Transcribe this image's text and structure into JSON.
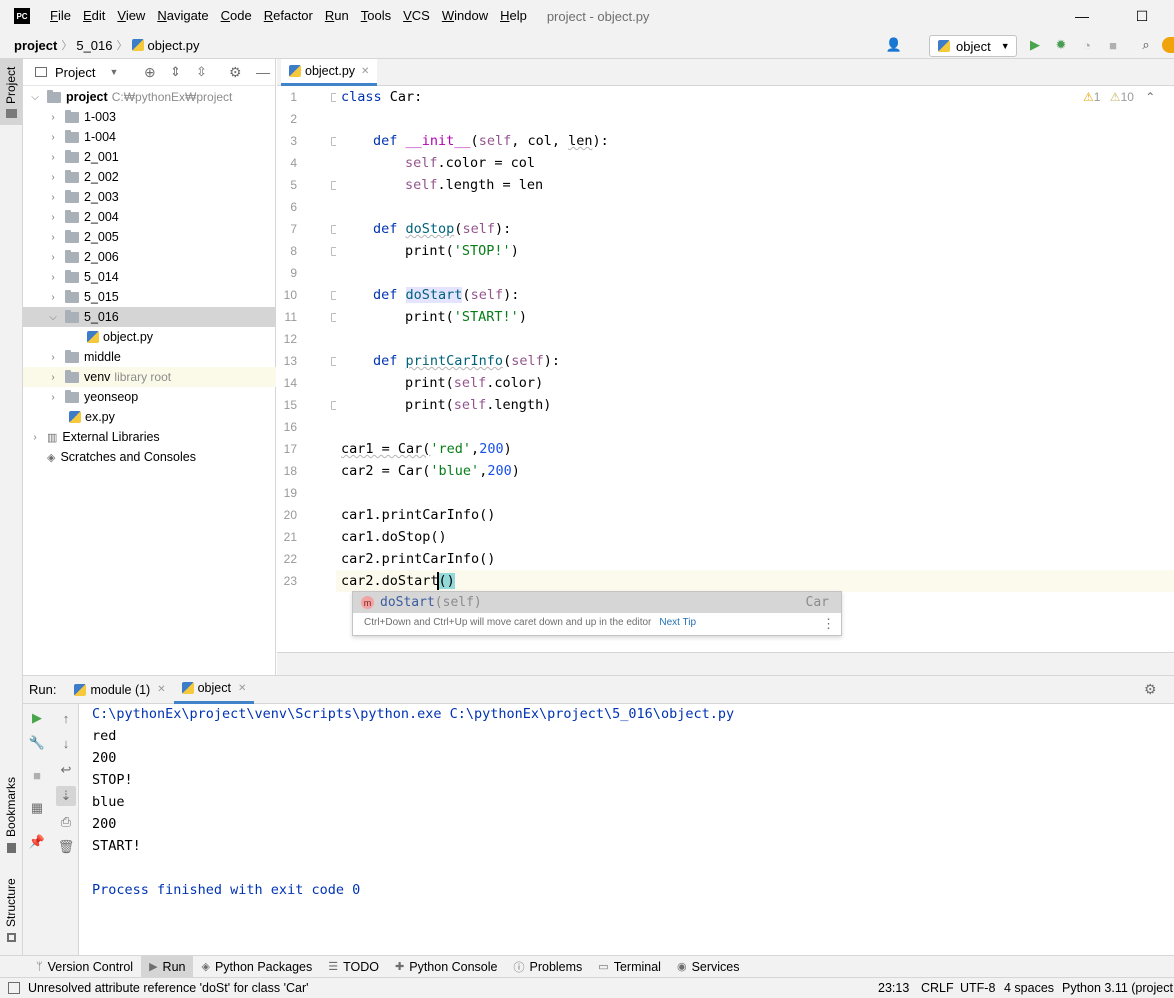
{
  "title_bar": {
    "logo_text": "PC",
    "menu": [
      {
        "label": "File",
        "u": "F",
        "rest": "ile"
      },
      {
        "label": "Edit",
        "u": "E",
        "rest": "dit"
      },
      {
        "label": "View",
        "u": "V",
        "rest": "iew"
      },
      {
        "label": "Navigate",
        "u": "N",
        "rest": "avigate"
      },
      {
        "label": "Code",
        "u": "C",
        "rest": "ode"
      },
      {
        "label": "Refactor",
        "u": "R",
        "rest": "efactor"
      },
      {
        "label": "Run",
        "u": "R",
        "rest": "un"
      },
      {
        "label": "Tools",
        "u": "T",
        "rest": "ools"
      },
      {
        "label": "VCS",
        "u": "V",
        "rest": "CS"
      },
      {
        "label": "Window",
        "u": "W",
        "rest": "indow"
      },
      {
        "label": "Help",
        "u": "H",
        "rest": "elp"
      }
    ],
    "window_title": "project - object.py",
    "minimize": "—",
    "maximize": "☐",
    "close": "✕"
  },
  "nav_bar": {
    "crumbs": [
      "project",
      "5_016",
      "object.py"
    ],
    "run_config": "object"
  },
  "left_stripe": {
    "project": "Project",
    "bookmarks": "Bookmarks",
    "structure": "Structure"
  },
  "project_panel": {
    "title": "Project",
    "root": {
      "name": "project",
      "path": "C:₩pythonEx₩project"
    },
    "folders": [
      "1-003",
      "1-004",
      "2_001",
      "2_002",
      "2_003",
      "2_004",
      "2_005",
      "2_006",
      "5_014",
      "5_015",
      "5_016"
    ],
    "open_file": "object.py",
    "more_folders": [
      "middle"
    ],
    "venv": {
      "name": "venv",
      "hint": "library root"
    },
    "yeonseop": "yeonseop",
    "ex_file": "ex.py",
    "external": "External Libraries",
    "scratches": "Scratches and Consoles"
  },
  "editor": {
    "tab": "object.py",
    "inspections": {
      "warnings": "1",
      "weak_warnings": "10"
    },
    "line_numbers": [
      "1",
      "2",
      "3",
      "4",
      "5",
      "6",
      "7",
      "8",
      "9",
      "10",
      "11",
      "12",
      "13",
      "14",
      "15",
      "16",
      "17",
      "18",
      "19",
      "20",
      "21",
      "22",
      "23"
    ],
    "lines": {
      "l1_kw": "class",
      "l1_rest": " Car:",
      "l3_kw": "def ",
      "l3_fn": "__init__",
      "l3_a": "(",
      "l3_self": "self",
      "l3_b": ", col, ",
      "l3_len": "len",
      "l3_c": "):",
      "l4_self": "self",
      "l4_rest": ".color = col",
      "l5_self": "self",
      "l5_rest": ".length = len",
      "l7_kw": "def ",
      "l7_fn": "doStop",
      "l7_a": "(",
      "l7_self": "self",
      "l7_b": "):",
      "l8_a": "print(",
      "l8_str": "'STOP!'",
      "l8_b": ")",
      "l10_kw": "def ",
      "l10_fn": "doStart",
      "l10_a": "(",
      "l10_self": "self",
      "l10_b": "):",
      "l11_a": "print(",
      "l11_str": "'START!'",
      "l11_b": ")",
      "l13_kw": "def ",
      "l13_fn": "printCarInfo",
      "l13_a": "(",
      "l13_self": "self",
      "l13_b": "):",
      "l14_a": "print(",
      "l14_self": "self",
      "l14_b": ".color)",
      "l15_a": "print(",
      "l15_self": "self",
      "l15_b": ".length)",
      "l17_a": "car1 = Car(",
      "l17_str": "'red'",
      "l17_b": ",",
      "l17_num": "200",
      "l17_c": ")",
      "l18_a": "car2 = Car(",
      "l18_str": "'blue'",
      "l18_b": ",",
      "l18_num": "200",
      "l18_c": ")",
      "l20": "car1.printCarInfo()",
      "l21": "car1.doStop()",
      "l22": "car2.printCarInfo()",
      "l23_a": "car2.doStart",
      "l23_b": "()"
    },
    "completion": {
      "badge": "m",
      "name": "doStart",
      "params": "(self)",
      "type": "Car",
      "tip": "Ctrl+Down and Ctrl+Up will move caret down and up in the editor",
      "next_tip": "Next Tip",
      "more": "⋮"
    }
  },
  "run_panel": {
    "label": "Run:",
    "tabs": [
      "module (1)",
      "object"
    ],
    "console": [
      "C:\\pythonEx\\project\\venv\\Scripts\\python.exe C:\\pythonEx\\project\\5_016\\object.py",
      "red",
      "200",
      "STOP!",
      "blue",
      "200",
      "START!",
      "",
      "Process finished with exit code 0"
    ]
  },
  "bottom_tools": [
    "Version Control",
    "Run",
    "Python Packages",
    "TODO",
    "Python Console",
    "Problems",
    "Terminal",
    "Services"
  ],
  "status_bar": {
    "message": "Unresolved attribute reference 'doSt' for class 'Car'",
    "position": "23:13",
    "line_sep": "CRLF",
    "encoding": "UTF-8",
    "indent": "4 spaces",
    "interpreter": "Python 3.11 (project"
  },
  "colors": {
    "accent": "#4083c9",
    "keyword": "#0033b3",
    "string": "#067d17",
    "self": "#94558d",
    "number": "#1750eb"
  }
}
